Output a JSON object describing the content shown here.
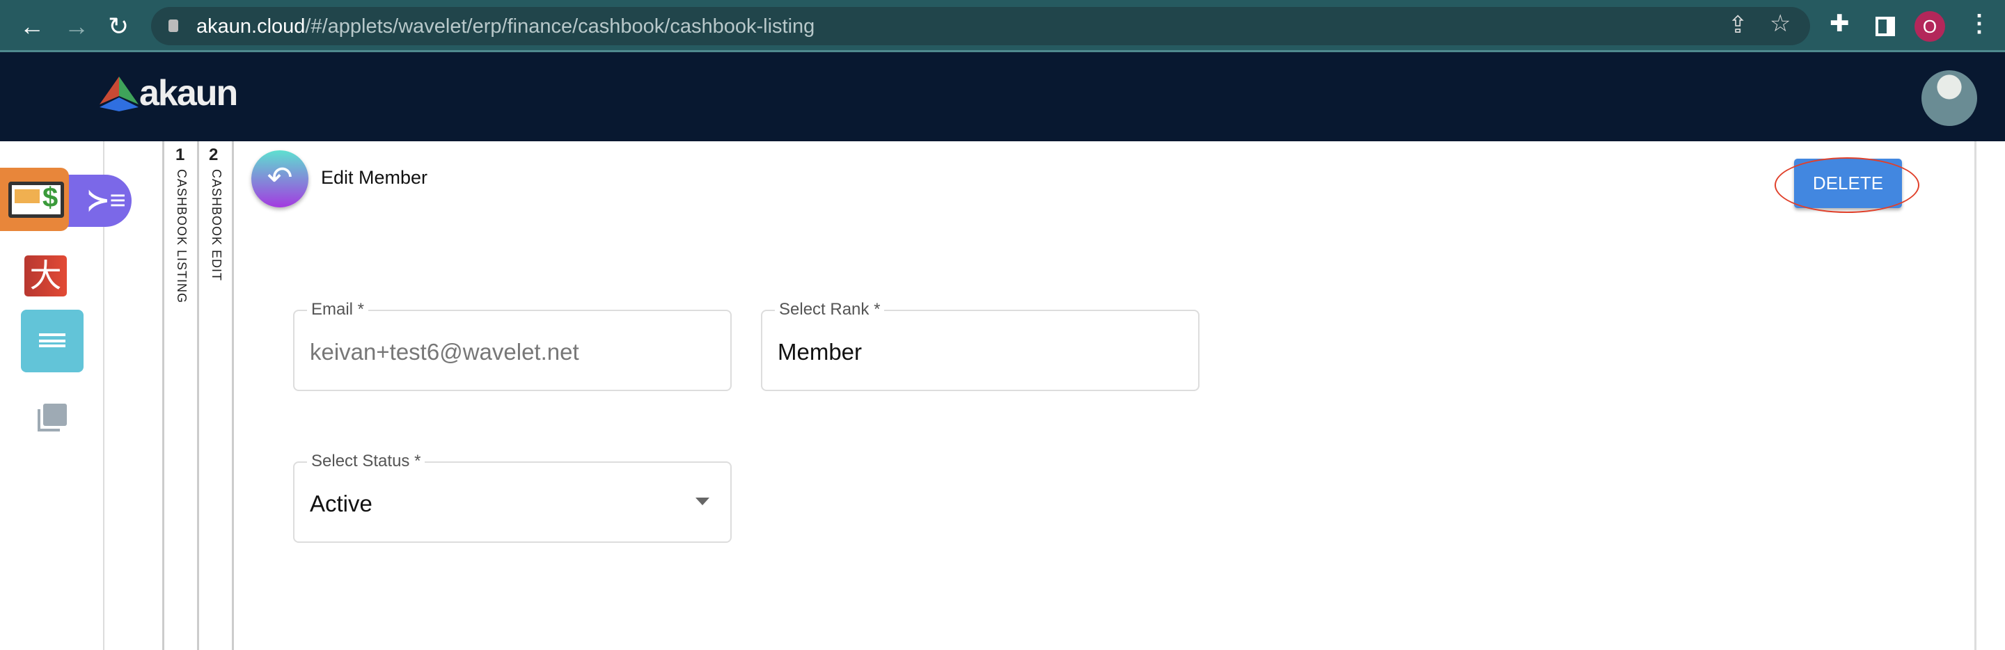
{
  "browser": {
    "url_domain": "akaun.cloud",
    "url_path": "/#/applets/wavelet/erp/finance/cashbook/cashbook-listing",
    "profile_initial": "O"
  },
  "header": {
    "logo_text": "akaun"
  },
  "tabs": [
    {
      "number": "1",
      "label": "CASHBOOK LISTING"
    },
    {
      "number": "2",
      "label": "CASHBOOK EDIT"
    }
  ],
  "page": {
    "title": "Edit Member",
    "delete_label": "DELETE"
  },
  "form": {
    "email": {
      "label": "Email *",
      "value": "keivan+test6@wavelet.net"
    },
    "rank": {
      "label": "Select Rank *",
      "value": "Member"
    },
    "status": {
      "label": "Select Status *",
      "value": "Active"
    }
  },
  "colors": {
    "header": "#081830",
    "delete": "#4287e0",
    "highlight": "#e0402a"
  }
}
